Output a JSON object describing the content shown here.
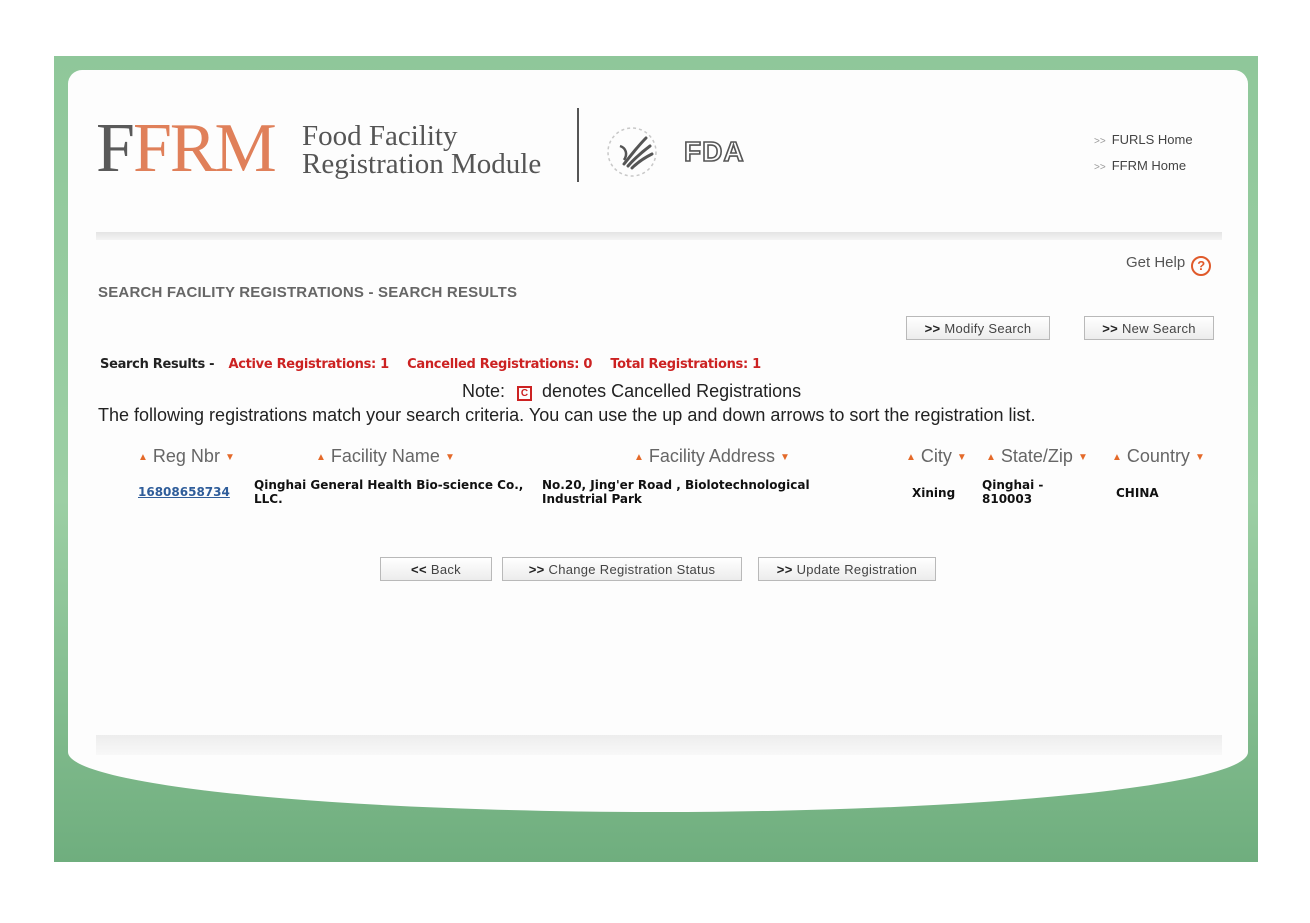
{
  "header": {
    "logo_first": "F",
    "logo_rest": "FRM",
    "logo_line1": "Food Facility",
    "logo_line2": "Registration Module",
    "fda_text": "FDA",
    "links": [
      {
        "label": "FURLS Home"
      },
      {
        "label": "FFRM Home"
      }
    ]
  },
  "help": {
    "label": "Get Help",
    "icon": "?"
  },
  "page_title": "SEARCH FACILITY REGISTRATIONS - SEARCH RESULTS",
  "toolbar": {
    "modify_search": "Modify Search",
    "new_search": "New Search"
  },
  "summary": {
    "label": "Search Results -",
    "active": "Active Registrations: 1",
    "cancelled": "Cancelled Registrations: 0",
    "total": "Total Registrations: 1"
  },
  "note": {
    "prefix": "Note:",
    "icon": "C",
    "text": "denotes Cancelled Registrations"
  },
  "instructions": "The following registrations match your search criteria. You can use the up and down arrows to sort the registration list.",
  "table": {
    "columns": [
      "Reg Nbr",
      "Facility Name",
      "Facility Address",
      "City",
      "State/Zip",
      "Country"
    ],
    "rows": [
      {
        "reg_nbr": "16808658734",
        "facility_name": "Qinghai General Health Bio-science Co., LLC.",
        "facility_address": "No.20, Jing'er Road , Biolotechnological Industrial Park",
        "city": "Xining",
        "state_zip": "Qinghai - 810003",
        "country": "CHINA"
      }
    ]
  },
  "actions": {
    "back": "Back",
    "change_status": "Change Registration Status",
    "update": "Update Registration"
  },
  "colors": {
    "accent_red": "#cc2222",
    "sort_arrow": "#e46a2a",
    "link_blue": "#2f5d9a",
    "frame_green": "#8fc79a"
  }
}
